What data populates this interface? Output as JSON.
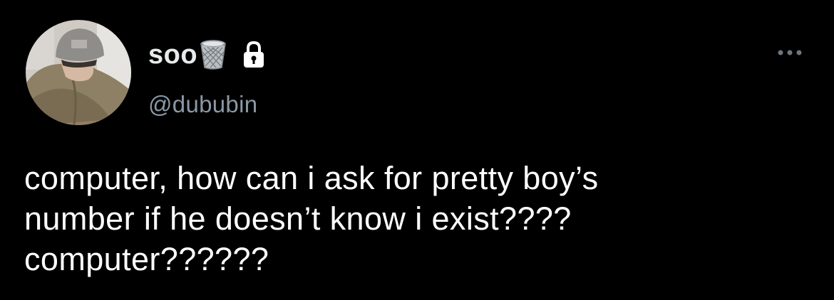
{
  "colors": {
    "background": "#000000",
    "text_primary": "#ffffff",
    "text_secondary": "#8b98a5"
  },
  "author": {
    "display_name": "soo",
    "name_emoji": "wastebasket-emoji",
    "protected_icon": "lock-icon",
    "handle": "@dububin",
    "avatar": "profile-photo"
  },
  "menu": {
    "icon": "more-options-icon"
  },
  "tweet": {
    "lines": [
      "computer, how can i ask for pretty boy’s",
      "number if he doesn’t know i exist????",
      "computer??????"
    ]
  }
}
